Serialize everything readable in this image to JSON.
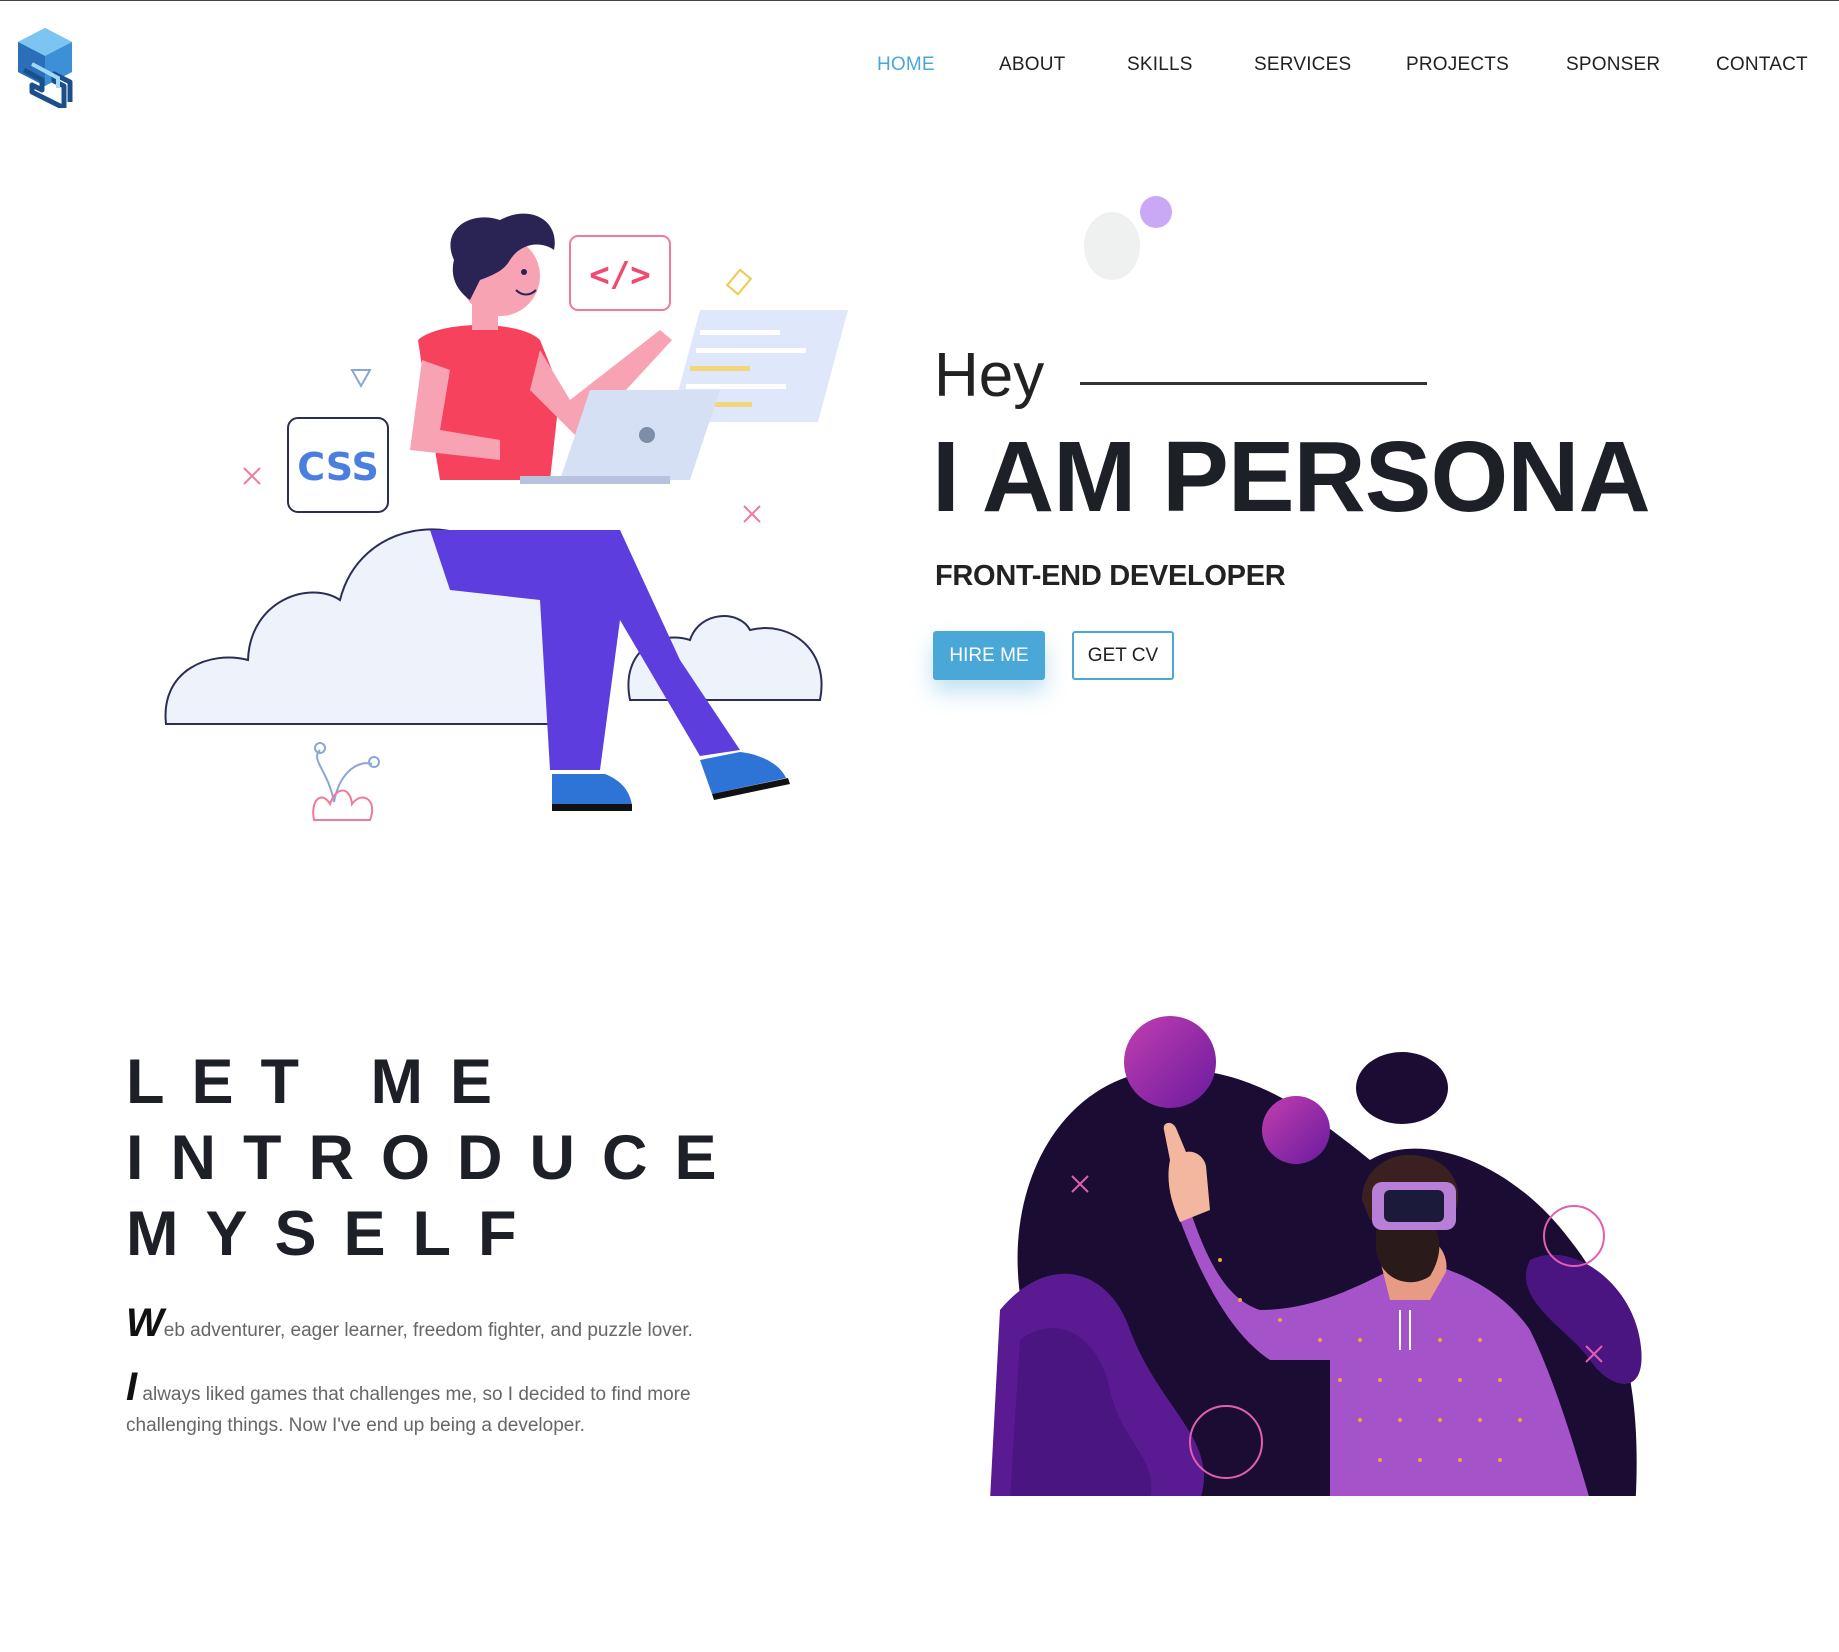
{
  "nav": {
    "items": [
      {
        "label": "HOME",
        "active": true
      },
      {
        "label": "ABOUT",
        "active": false
      },
      {
        "label": "SKILLS",
        "active": false
      },
      {
        "label": "SERVICES",
        "active": false
      },
      {
        "label": "PROJECTS",
        "active": false
      },
      {
        "label": "SPONSER",
        "active": false
      },
      {
        "label": "CONTACT",
        "active": false
      }
    ]
  },
  "hero": {
    "greeting": "Hey",
    "name": "I AM PERSONA",
    "role": "FRONT-END DEVELOPER",
    "hire_label": "HIRE ME",
    "cv_label": "GET CV",
    "illustration": {
      "css_badge": "CSS",
      "code_tag": "</>"
    }
  },
  "intro": {
    "title_lines": [
      "LET ME",
      "INTRODUCE",
      "MYSELF"
    ],
    "para1_cap": "W",
    "para1_text": "eb adventurer, eager learner, freedom fighter, and puzzle lover.",
    "para2_cap": "I",
    "para2_text": " always liked games that challenges me, so I decided to find more challenging things. Now I've end up being a developer."
  },
  "colors": {
    "accent": "#4aa8d8",
    "text": "#1e2027",
    "shirt": "#f7425e",
    "pants": "#5e3ddf",
    "blob": "#1b0c33",
    "hoodie": "#a553c9"
  }
}
